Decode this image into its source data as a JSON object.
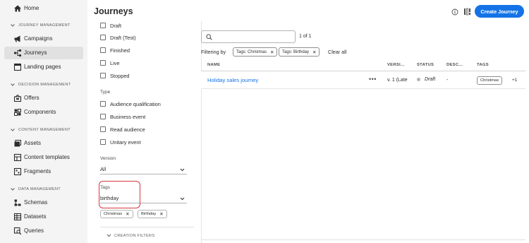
{
  "nav": {
    "home": "Home",
    "sections": [
      {
        "title": "JOURNEY MANAGEMENT",
        "items": [
          "Campaigns",
          "Journeys",
          "Landing pages"
        ]
      },
      {
        "title": "DECISION MANAGEMENT",
        "items": [
          "Offers",
          "Components"
        ]
      },
      {
        "title": "CONTENT MANAGEMENT",
        "items": [
          "Assets",
          "Content templates",
          "Fragments"
        ]
      },
      {
        "title": "DATA MANAGEMENT",
        "items": [
          "Schemas",
          "Datasets",
          "Queries"
        ]
      }
    ],
    "active": "Journeys"
  },
  "header": {
    "title": "Journeys",
    "create_button": "Create Journey"
  },
  "filters": {
    "status_options": [
      "Draft",
      "Draft (Test)",
      "Finished",
      "Live",
      "Stopped"
    ],
    "type_label": "Type",
    "type_options": [
      "Audience qualification",
      "Business event",
      "Read audience",
      "Unitary event"
    ],
    "version_label": "Version",
    "version_value": "All",
    "tags_label": "Tags",
    "tags_value": "birthday",
    "tag_chips": [
      "Christmas",
      "Birthday"
    ],
    "creation_filters": "CREATION FILTERS"
  },
  "results": {
    "search_placeholder": "",
    "count": "1 of 1",
    "filtering_by": "Filtering by",
    "active_filters": [
      "Tags: Christmas",
      "Tags: Birthday"
    ],
    "clear_all": "Clear all",
    "columns": [
      "NAME",
      "VERSI...",
      "STATUS",
      "DESC...",
      "TAGS"
    ],
    "rows": [
      {
        "name": "Holiday sales journey",
        "more": "•••",
        "version": "v. 1 (Late",
        "status": "Draft",
        "description": "-",
        "tag": "Christmas",
        "more_tags": "+1"
      }
    ]
  },
  "colors": {
    "accent": "#1473e6",
    "highlight": "#d7373f"
  }
}
